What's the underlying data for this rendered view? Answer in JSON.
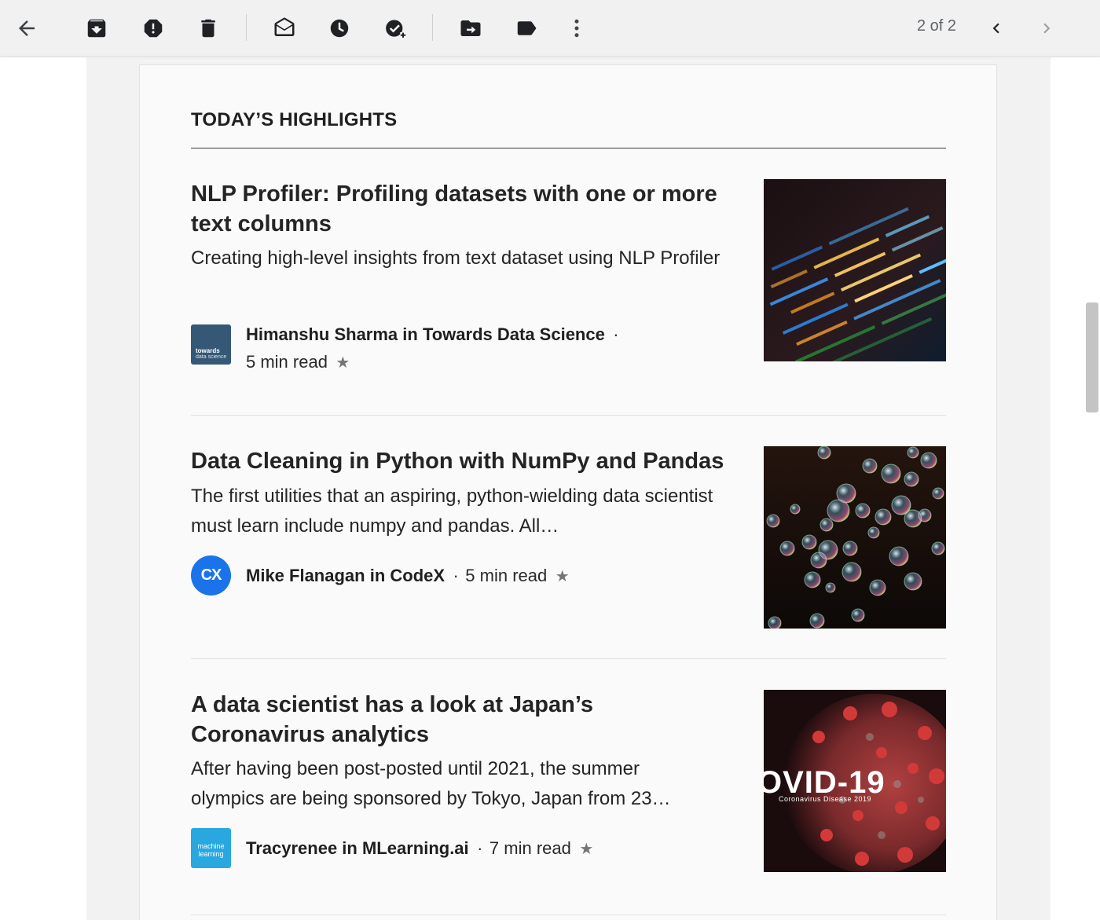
{
  "toolbar": {
    "icons": [
      "back-arrow-icon",
      "archive-icon",
      "report-spam-icon",
      "trash-icon",
      "mark-unread-icon",
      "snooze-icon",
      "add-task-icon",
      "move-to-icon",
      "label-icon",
      "more-options-icon"
    ],
    "pager": "2 of 2"
  },
  "section": {
    "heading": "TODAY’S HIGHLIGHTS"
  },
  "articles": [
    {
      "title": "NLP Profiler: Profiling datasets with one or more text columns",
      "subtitle": "Creating high-level insights from text dataset using NLP Profiler",
      "author": "Himanshu Sharma in Towards Data Science",
      "sep": "·",
      "read_time": "5 min read",
      "star": "★",
      "pub_logo_line1": "towards",
      "pub_logo_line2": "data science",
      "pub_color": "#355876"
    },
    {
      "title": "Data Cleaning in Python with NumPy and Pandas",
      "subtitle": "The first utilities that an aspiring, python-wielding data scientist must learn include numpy and pandas. All…",
      "author": "Mike Flanagan in CodeX",
      "sep": "·",
      "read_time": "5 min read",
      "star": "★",
      "pub_logo_text": "CX",
      "pub_color": "#1a73e8"
    },
    {
      "title": "A data scientist has a look at Japan’s Coronavirus analytics",
      "subtitle": "After having been post-posted until 2021, the summer olympics are being sponsored by Tokyo, Japan from 23…",
      "author": "Tracyrenee in MLearning.ai",
      "sep": "·",
      "read_time": "7 min read",
      "star": "★",
      "pub_logo_text": "machine learning",
      "pub_color": "#29a8e0",
      "thumb_text_main": "OVID-19",
      "thumb_text_sub": "Coronavirus Disease 2019"
    }
  ],
  "colors": {
    "toolbar_bg": "#f1f1f1",
    "frame_bg": "#f2f2f2",
    "card_bg": "#fafafa",
    "text": "#242424"
  }
}
